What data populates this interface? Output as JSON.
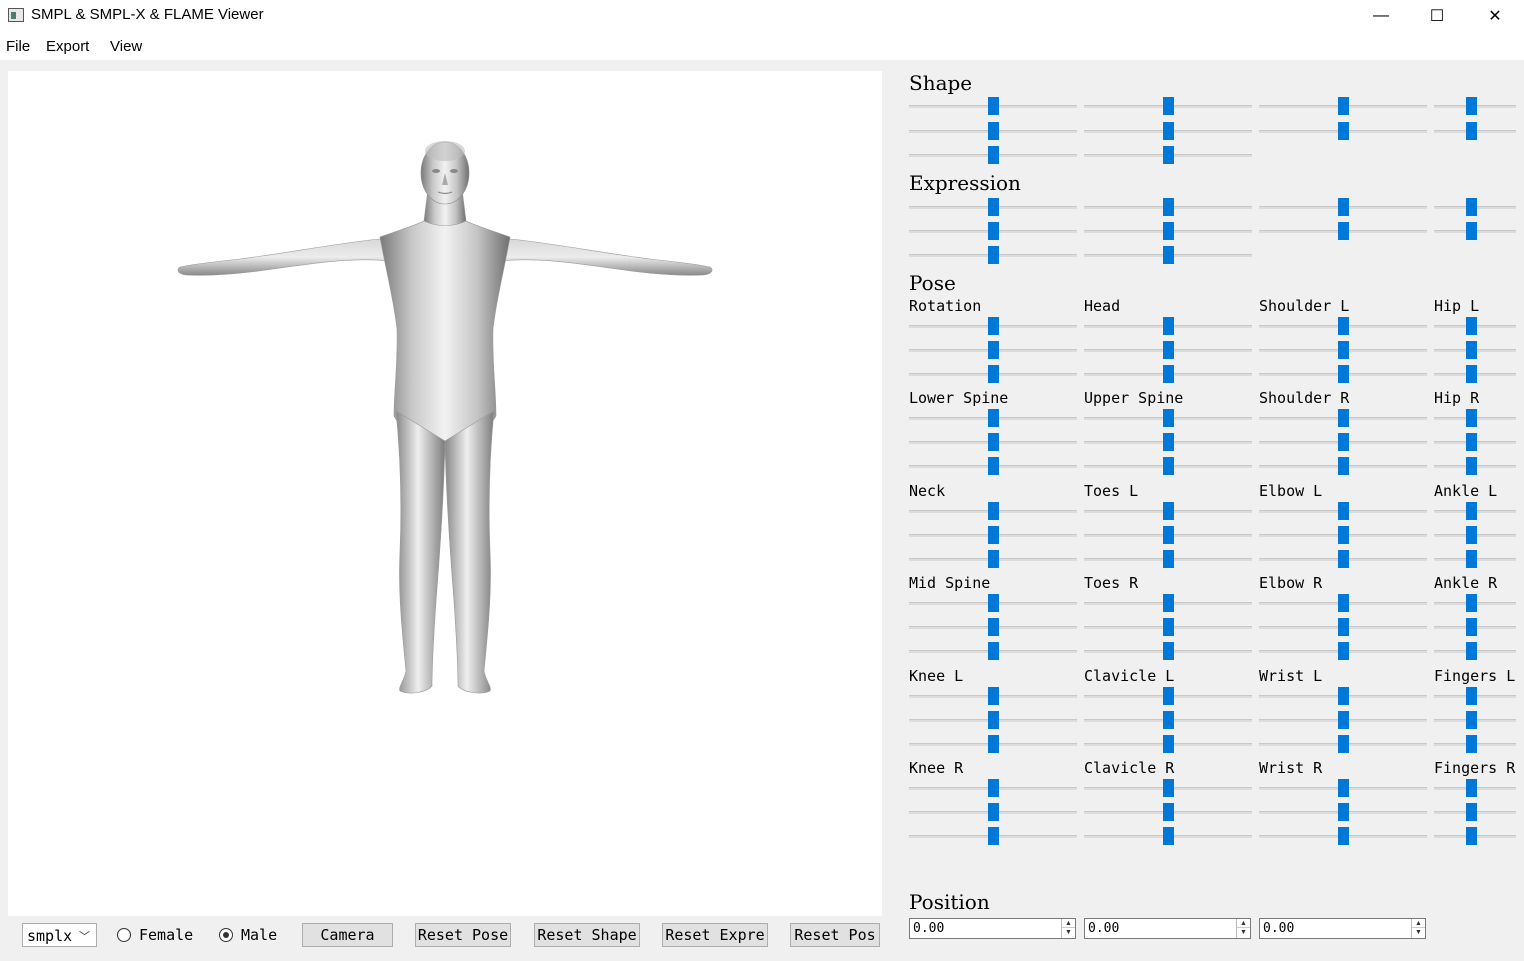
{
  "window": {
    "title": "SMPL & SMPL-X & FLAME Viewer",
    "minimize_glyph": "—",
    "maximize_glyph": "☐",
    "close_glyph": "✕"
  },
  "menu": [
    "File",
    "Export",
    "View"
  ],
  "sections": {
    "shape": "Shape",
    "expression": "Expression",
    "pose": "Pose",
    "position": "Position"
  },
  "slider_value": 0.5,
  "pose_groups": [
    [
      "Rotation",
      "Head",
      "Shoulder L",
      "Hip L"
    ],
    [
      "Lower Spine",
      "Upper Spine",
      "Shoulder R",
      "Hip R"
    ],
    [
      "Neck",
      "Toes L",
      "Elbow L",
      "Ankle L"
    ],
    [
      "Mid Spine",
      "Toes R",
      "Elbow R",
      "Ankle R"
    ],
    [
      "Knee L",
      "Clavicle L",
      "Wrist L",
      "Fingers L"
    ],
    [
      "Knee R",
      "Clavicle R",
      "Wrist R",
      "Fingers R"
    ]
  ],
  "position": [
    "0.00",
    "0.00",
    "0.00"
  ],
  "bottom": {
    "model": "smplx",
    "female": "Female",
    "male": "Male",
    "selected_gender": "Male",
    "camera": "Camera",
    "reset_pose": "Reset Pose",
    "reset_shape": "Reset Shape",
    "reset_expression": "Reset Expre",
    "reset_pos": "Reset Pos"
  }
}
